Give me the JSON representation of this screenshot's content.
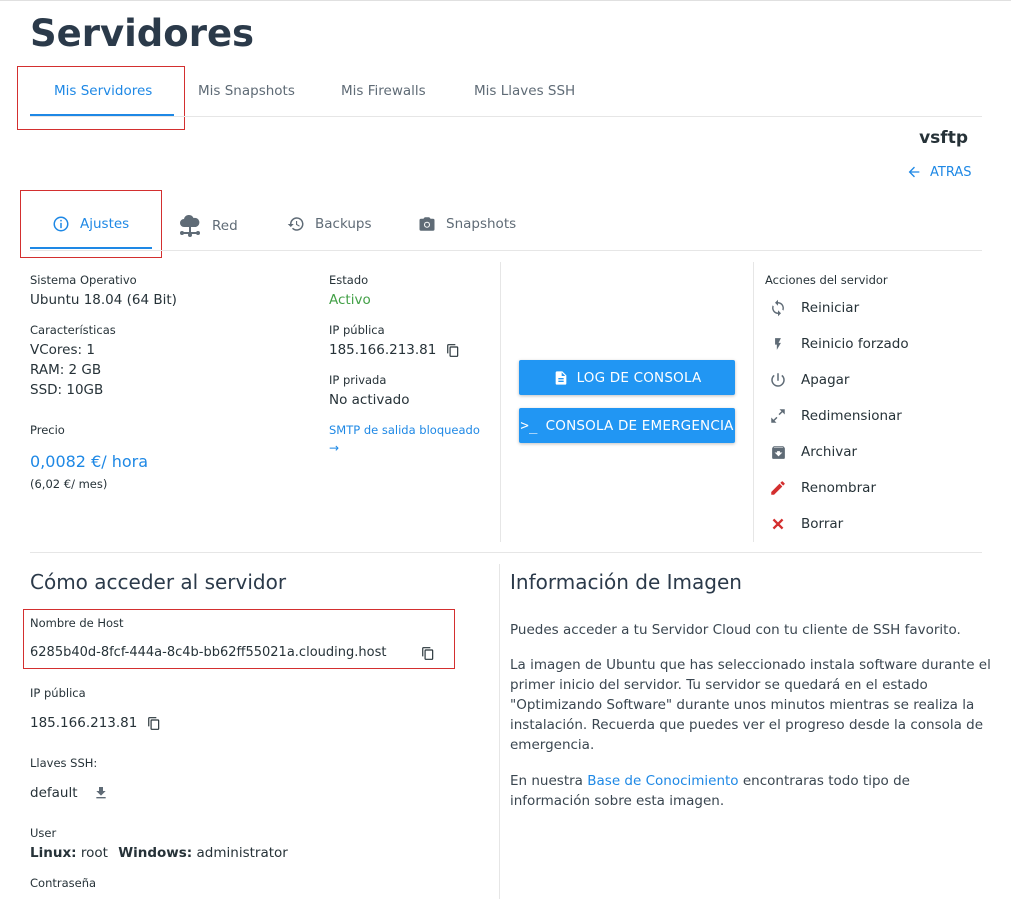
{
  "page": {
    "title": "Servidores"
  },
  "main_tabs": [
    {
      "label": "Mis Servidores"
    },
    {
      "label": "Mis Snapshots"
    },
    {
      "label": "Mis Firewalls"
    },
    {
      "label": "Mis Llaves SSH"
    }
  ],
  "server": {
    "name": "vsftp",
    "back_label": "ATRAS"
  },
  "sub_tabs": [
    {
      "label": "Ajustes",
      "icon": "info-icon"
    },
    {
      "label": "Red",
      "icon": "cloud-network-icon"
    },
    {
      "label": "Backups",
      "icon": "history-icon"
    },
    {
      "label": "Snapshots",
      "icon": "camera-icon"
    }
  ],
  "settings": {
    "os_label": "Sistema Operativo",
    "os_value": "Ubuntu 18.04 (64 Bit)",
    "features_label": "Características",
    "vcores": "VCores: 1",
    "ram": "RAM: 2 GB",
    "ssd": "SSD: 10GB",
    "price_label": "Precio",
    "price_hour": "0,0082 €/ hora",
    "price_month": "(6,02 €/ mes)",
    "status_label": "Estado",
    "status_value": "Activo",
    "public_ip_label": "IP pública",
    "public_ip": "185.166.213.81",
    "private_ip_label": "IP privada",
    "private_ip": "No activado",
    "smtp_link": "SMTP de salida bloqueado",
    "smtp_arrow": "→"
  },
  "buttons": {
    "console_log": "LOG DE CONSOLA",
    "emergency_console": "CONSOLA DE EMERGENCIA"
  },
  "actions": {
    "title": "Acciones del servidor",
    "items": [
      {
        "label": "Reiniciar",
        "icon": "restart-icon"
      },
      {
        "label": "Reinicio forzado",
        "icon": "bolt-icon"
      },
      {
        "label": "Apagar",
        "icon": "power-icon"
      },
      {
        "label": "Redimensionar",
        "icon": "resize-icon"
      },
      {
        "label": "Archivar",
        "icon": "archive-icon"
      },
      {
        "label": "Renombrar",
        "icon": "pencil-icon"
      },
      {
        "label": "Borrar",
        "icon": "close-icon"
      }
    ]
  },
  "access": {
    "title": "Cómo acceder al servidor",
    "hostname_label": "Nombre de Host",
    "hostname": "6285b40d-8fcf-444a-8c4b-bb62ff55021a.clouding.host",
    "public_ip_label": "IP pública",
    "public_ip": "185.166.213.81",
    "ssh_keys_label": "Llaves SSH:",
    "ssh_key": "default",
    "user_label": "User",
    "linux_label": "Linux:",
    "linux_user": "root",
    "windows_label": "Windows:",
    "windows_user": "administrator",
    "password_label": "Contraseña"
  },
  "image_info": {
    "title": "Información de Imagen",
    "p1": "Puedes acceder a tu Servidor Cloud con tu cliente de SSH favorito.",
    "p2_l1": "La imagen de Ubuntu que has seleccionado instala software durante el",
    "p2_l2": "primer inicio del servidor. Tu servidor se quedará en el estado",
    "p2_l3": "\"Optimizando Software\" durante unos minutos mientras se realiza la",
    "p2_l4": "instalación. Recuerda que puedes ver el progreso desde la consola de",
    "p2_l5": "emergencia.",
    "p3_prefix": "En nuestra ",
    "p3_link": "Base de Conocimiento",
    "p3_suffix": " encontraras todo tipo de",
    "p3_l2": "información sobre esta imagen."
  },
  "colors": {
    "accent": "#1e88e5",
    "button": "#2196f3",
    "success": "#43a047",
    "danger": "#d32f2f",
    "highlight": "#d32f2f"
  }
}
